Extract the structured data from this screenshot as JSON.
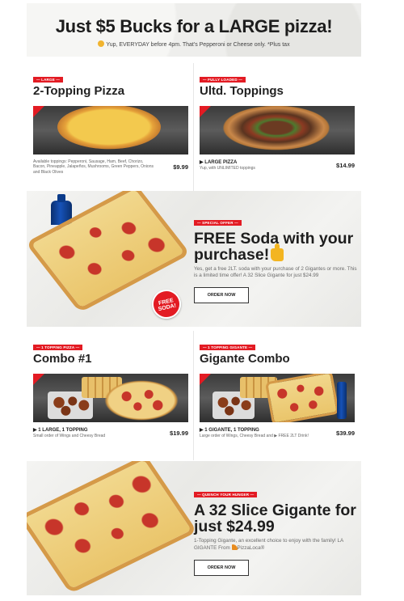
{
  "banner": {
    "title": "Just $5 Bucks for a LARGE pizza!",
    "subtitle": "Yup, EVERYDAY before 4pm. That's Pepperoni or Cheese only. *Plus tax"
  },
  "row1": {
    "left": {
      "tag": "— LARGE —",
      "name": "2-Topping Pizza",
      "description": "Available toppings: Pepperoni, Sausage, Ham, Beef, Chorizo, Bacon, Pineapple, Jalapeños, Mushrooms, Green Peppers, Onions and Black Olives",
      "price": "$9.99"
    },
    "right": {
      "tag": "— FULLY LOADED —",
      "name": "Ultd. Toppings",
      "line1": "▶ LARGE PIZZA",
      "line2": "Yup, with UNLIMITED toppings",
      "price": "$14.99"
    }
  },
  "promo1": {
    "tag": "— SPECIAL OFFER —",
    "headline": "FREE Soda with your purchase!",
    "body": "Yes, get a free 2LT. soda with your purchase of 2 Gigantes or more. This is a limited time offer! A 32 Slice Gigante for just $24.99",
    "badge": "FREE SODA!",
    "button": "ORDER NOW",
    "bottle_label": "pepsi"
  },
  "row2": {
    "left": {
      "tag": "— 1 TOPPING PIZZA —",
      "name": "Combo #1",
      "line1": "▶ 1 LARGE, 1 TOPPING",
      "line2": "Small order of Wings and Cheesy Bread",
      "price": "$19.99"
    },
    "right": {
      "tag": "— 1 TOPPING GIGANTE —",
      "name": "Gigante Combo",
      "line1": "▶ 1 GIGANTE, 1 TOPPING",
      "line2": "Large order of Wings, Cheesy Bread and ▶ FREE 2LT Drink!",
      "price": "$39.99"
    }
  },
  "promo2": {
    "tag": "— QUENCH YOUR HUNGER —",
    "headline": "A 32 Slice Gigante for just $24.99",
    "body_pre": "1-Topping Gigante, an excellent choice to enjoy with the family! LA GIGANTE From ",
    "brand": "PizzaLoca®",
    "button": "ORDER NOW"
  },
  "colors": {
    "accent": "#e31b23",
    "text": "#1f1f1f",
    "muted": "#666666"
  }
}
